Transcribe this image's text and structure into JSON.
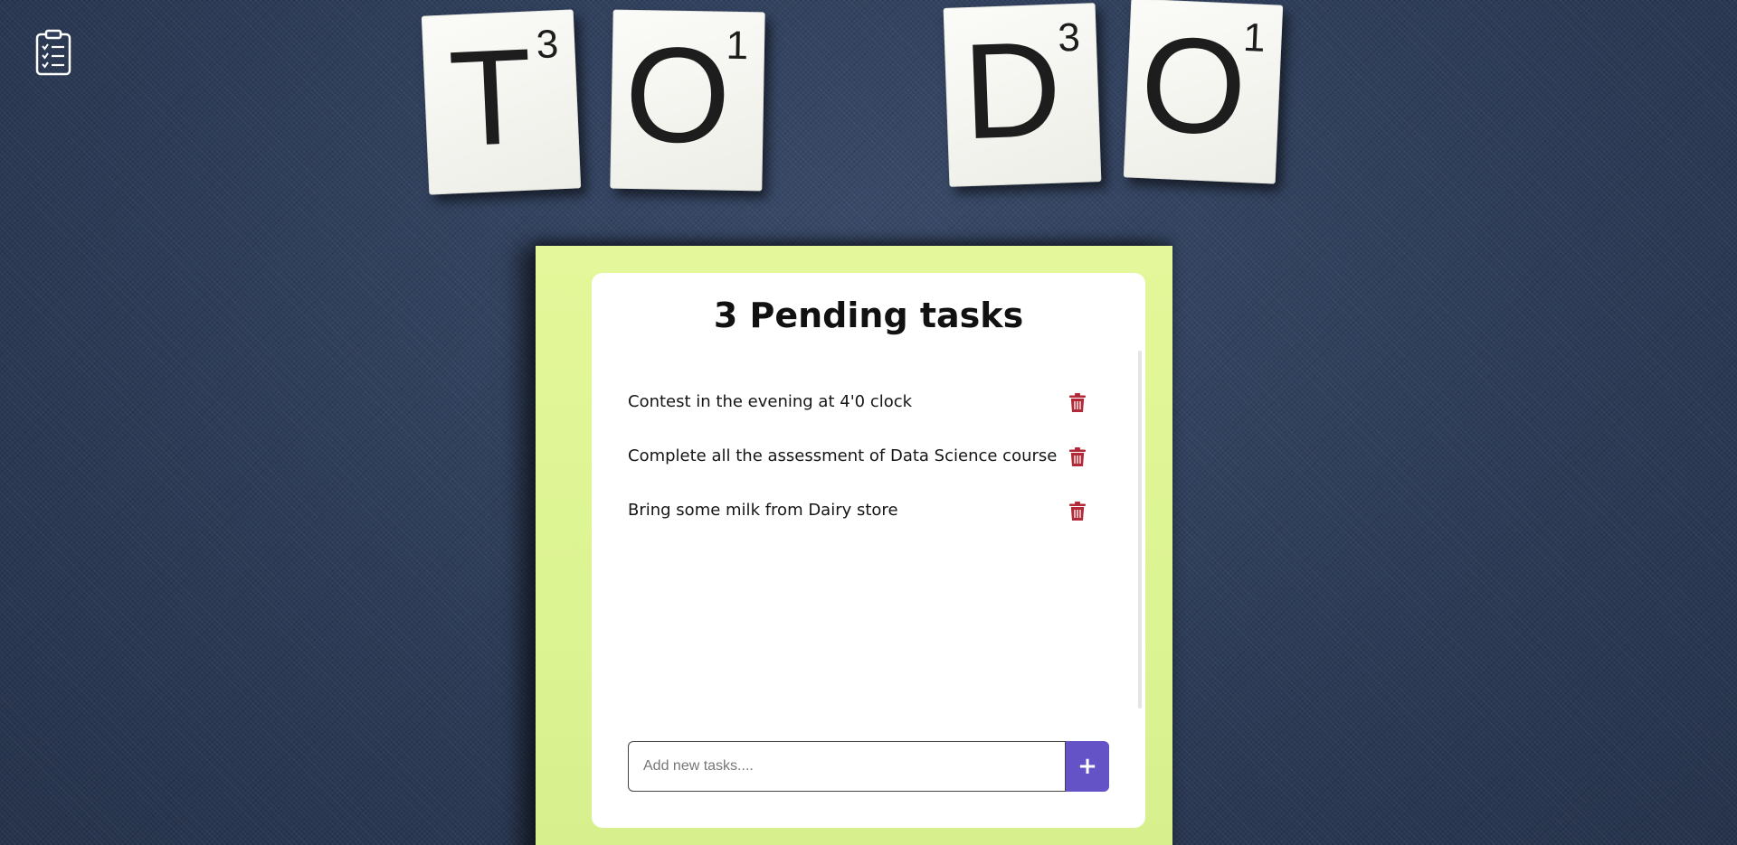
{
  "app": {
    "logo_icon": "clipboard-list-icon"
  },
  "tiles": [
    {
      "letter": "T",
      "score": "3"
    },
    {
      "letter": "O",
      "score": "1"
    },
    {
      "letter": "D",
      "score": "3"
    },
    {
      "letter": "O",
      "score": "1"
    }
  ],
  "main": {
    "title": "3 Pending tasks",
    "tasks": [
      {
        "text": "Contest in the evening at 4'0 clock",
        "delete_icon": "trash-icon"
      },
      {
        "text": "Complete all the assessment of Data Science course",
        "delete_icon": "trash-icon"
      },
      {
        "text": "Bring some milk from Dairy store",
        "delete_icon": "trash-icon"
      }
    ]
  },
  "add_form": {
    "value": "",
    "placeholder": "Add new tasks....",
    "add_label": "+"
  },
  "colors": {
    "background": "#2f3f5c",
    "note": "#dcf492",
    "accent": "#6353c7",
    "delete": "#b02a37"
  }
}
